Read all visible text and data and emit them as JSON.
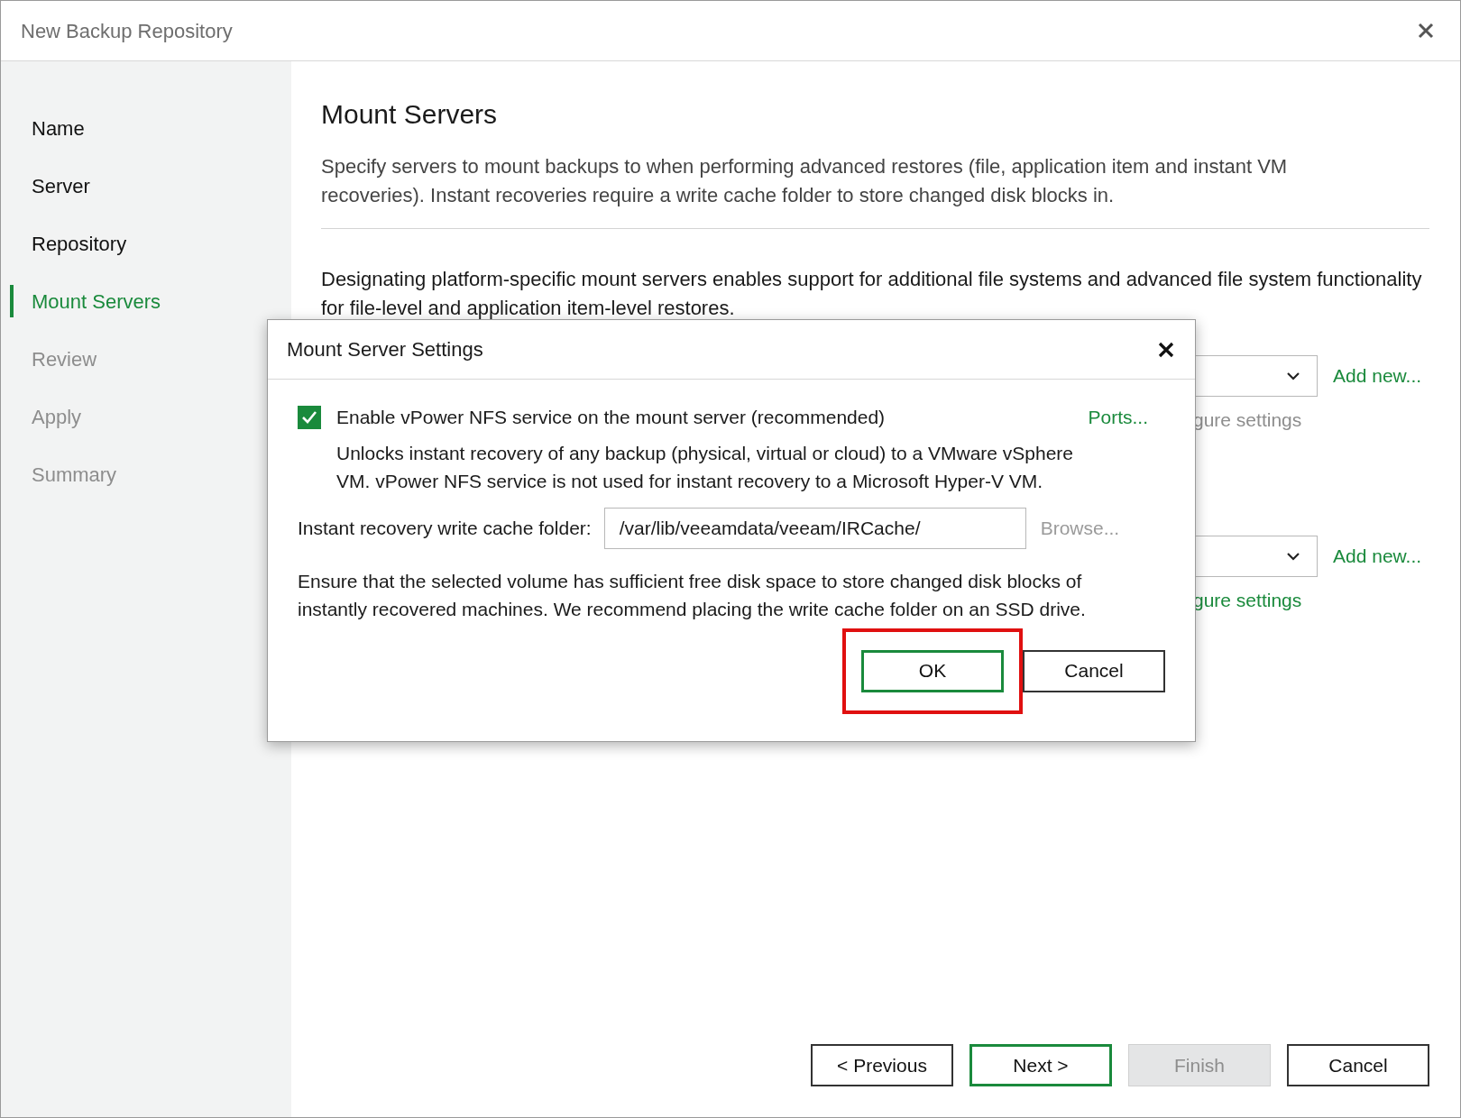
{
  "window": {
    "title": "New Backup Repository"
  },
  "steps": [
    {
      "label": "Name",
      "selected": false,
      "disabled": false
    },
    {
      "label": "Server",
      "selected": false,
      "disabled": false
    },
    {
      "label": "Repository",
      "selected": false,
      "disabled": false
    },
    {
      "label": "Mount Servers",
      "selected": true,
      "disabled": false
    },
    {
      "label": "Review",
      "selected": false,
      "disabled": true
    },
    {
      "label": "Apply",
      "selected": false,
      "disabled": true
    },
    {
      "label": "Summary",
      "selected": false,
      "disabled": true
    }
  ],
  "page": {
    "heading": "Mount Servers",
    "description": "Specify servers to mount backups to when performing advanced restores (file, application item and instant VM recoveries). Instant recoveries require a write cache folder to store changed disk blocks in.",
    "note": "Designating platform-specific mount servers enables support for additional file systems and advanced file system functionality for file-level and application item-level restores.",
    "rows": [
      {
        "link": "Add new...",
        "settings_text": "gure settings",
        "settings_enabled": false
      },
      {
        "link": "Add new...",
        "settings_text": "gure settings",
        "settings_enabled": true
      }
    ]
  },
  "dialog": {
    "title": "Mount Server Settings",
    "checkbox": {
      "label": "Enable vPower NFS service on the mount server (recommended)",
      "checked": true
    },
    "ports": "Ports...",
    "description": "Unlocks instant recovery of any backup (physical, virtual or cloud) to a VMware vSphere VM.  vPower NFS service is not used for instant recovery to a Microsoft Hyper-V VM.",
    "folder": {
      "label": "Instant recovery write cache folder:",
      "value": "/var/lib/veeamdata/veeam/IRCache/"
    },
    "browse": {
      "label": "Browse...",
      "disabled": true
    },
    "note": "Ensure that the selected volume has sufficient free disk space to store changed disk blocks of instantly recovered machines. We recommend placing the write cache folder on an SSD drive.",
    "buttons": [
      {
        "label": "OK",
        "kind": "primary",
        "highlighted": true
      },
      {
        "label": "Cancel",
        "kind": "normal",
        "highlighted": false
      }
    ]
  },
  "footer": {
    "buttons": [
      {
        "label": "< Previous",
        "kind": "normal",
        "disabled": false
      },
      {
        "label": "Next >",
        "kind": "primary",
        "disabled": false
      },
      {
        "label": "Finish",
        "kind": "normal",
        "disabled": true
      },
      {
        "label": "Cancel",
        "kind": "normal",
        "disabled": false
      }
    ]
  }
}
